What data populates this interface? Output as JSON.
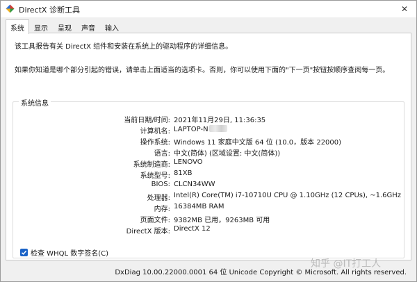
{
  "window": {
    "title": "DirectX 诊断工具",
    "close_glyph": "✕"
  },
  "tabs": [
    {
      "label": "系统",
      "active": true
    },
    {
      "label": "显示",
      "active": false
    },
    {
      "label": "呈现",
      "active": false
    },
    {
      "label": "声音",
      "active": false
    },
    {
      "label": "输入",
      "active": false
    }
  ],
  "intro": {
    "line1": "该工具报告有关 DirectX 组件和安装在系统上的驱动程序的详细信息。",
    "line2": "如果你知道是哪个部分引起的错误，请单击上面适当的选项卡。否则，你可以使用下面的\"下一页\"按钮按顺序查阅每一页。"
  },
  "system_info": {
    "legend": "系统信息",
    "rows": [
      {
        "label": "当前日期/时间:",
        "value": "2021年11月29日, 11:36:35"
      },
      {
        "label": "计算机名:",
        "value": "LAPTOP-N"
      },
      {
        "label": "操作系统:",
        "value": "Windows 11 家庭中文版 64 位 (10.0，版本 22000)"
      },
      {
        "label": "语言:",
        "value": "中文(简体) (区域设置: 中文(简体))"
      },
      {
        "label": "系统制造商:",
        "value": "LENOVO"
      },
      {
        "label": "系统型号:",
        "value": "81XB"
      },
      {
        "label": "BIOS:",
        "value": "CLCN34WW"
      },
      {
        "label": "处理器:",
        "value": "Intel(R) Core(TM) i7-10710U CPU @ 1.10GHz (12 CPUs), ~1.6GHz"
      },
      {
        "label": "内存:",
        "value": "16384MB RAM"
      },
      {
        "label": "页面文件:",
        "value": "9382MB 已用，9263MB 可用"
      },
      {
        "label": "DirectX 版本:",
        "value": "DirectX 12"
      }
    ]
  },
  "whql_checkbox": {
    "label": "检查 WHQL 数字签名(C)",
    "checked": true
  },
  "footer": {
    "text": "DxDiag 10.00.22000.0001 64 位 Unicode  Copyright © Microsoft. All rights reserved."
  },
  "watermark": {
    "text": "知乎 @IT打工人"
  },
  "colors": {
    "accent": "#1a63c7",
    "icon_red": "#d83b2b",
    "icon_green": "#2c9a45",
    "icon_yellow": "#f2b01e",
    "icon_blue": "#2a6fd6"
  }
}
